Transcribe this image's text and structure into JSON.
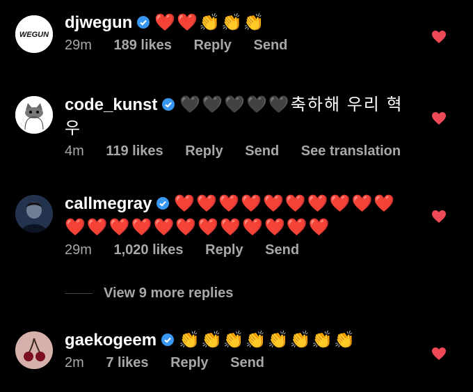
{
  "comments": [
    {
      "username": "djwegun",
      "avatar_text": "WEGUN",
      "text": "❤️❤️👏👏👏",
      "time": "29m",
      "likes": "189 likes",
      "reply": "Reply",
      "send": "Send"
    },
    {
      "username": "code_kunst",
      "text": "🖤🖤🖤🖤🖤축하해 우리 혁 우",
      "time": "4m",
      "likes": "119 likes",
      "reply": "Reply",
      "send": "Send",
      "translation": "See translation"
    },
    {
      "username": "callmegray",
      "text": "❤️❤️❤️❤️❤️❤️❤️❤️❤️❤️❤️❤️❤️❤️❤️❤️❤️❤️❤️❤️❤️❤️",
      "time": "29m",
      "likes": "1,020 likes",
      "reply": "Reply",
      "send": "Send"
    },
    {
      "username": "gaekogeem",
      "text": "👏👏👏👏👏👏👏👏",
      "time": "2m",
      "likes": "7 likes",
      "reply": "Reply",
      "send": "Send"
    }
  ],
  "view_more": "View 9 more replies",
  "colors": {
    "background": "#000000",
    "text": "#ffffff",
    "meta": "#a8a8a8",
    "heart": "#ed4956",
    "verified": "#3897f0"
  },
  "icons": [
    "verified-badge-icon",
    "heart-icon"
  ]
}
